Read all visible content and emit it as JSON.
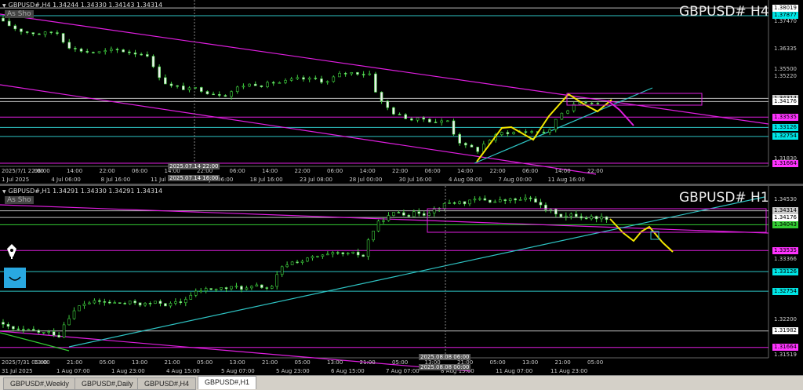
{
  "top_chart": {
    "symbol_info": "GBPUSD#,H4  1.34244 1.34330 1.34143 1.34314",
    "title": "GBPUSD#  H4",
    "as_show": "As Sho",
    "price_labels": [
      {
        "text": "1.38019",
        "bg": "#ffffff",
        "fg": "#000000",
        "y": 1.38019
      },
      {
        "text": "1.37877",
        "bg": "#00e5e5",
        "fg": "#000000",
        "y": 1.377
      },
      {
        "text": "1.37470",
        "bg": "",
        "fg": "#cccccc",
        "y": 1.3747
      },
      {
        "text": "1.36335",
        "bg": "",
        "fg": "#cccccc",
        "y": 1.36335
      },
      {
        "text": "1.35500",
        "bg": "",
        "fg": "#cccccc",
        "y": 1.355
      },
      {
        "text": "1.35220",
        "bg": "",
        "fg": "#cccccc",
        "y": 1.3522
      },
      {
        "text": "1.34314",
        "bg": "#cccccc",
        "fg": "#000000",
        "y": 1.3431
      },
      {
        "text": "1.34176",
        "bg": "#ffffff",
        "fg": "#000000",
        "y": 1.3418
      },
      {
        "text": "1.33535",
        "bg": "#ff33ff",
        "fg": "#000000",
        "y": 1.3354
      },
      {
        "text": "1.33126",
        "bg": "#00e5e5",
        "fg": "#000000",
        "y": 1.3312
      },
      {
        "text": "1.32754",
        "bg": "#00e5e5",
        "fg": "#000000",
        "y": 1.3275
      },
      {
        "text": "1.31830",
        "bg": "",
        "fg": "#cccccc",
        "y": 1.3183
      },
      {
        "text": "1.31664",
        "bg": "#ff33ff",
        "fg": "#000000",
        "y": 1.3165
      }
    ],
    "time_labels": [
      "2025/7/1 22:00",
      "06:00",
      "14:00",
      "22:00",
      "06:00",
      "14:00",
      "22:00",
      "06:00",
      "14:00",
      "22:00",
      "06:00",
      "14:00",
      "22:00",
      "06:00",
      "14:00",
      "22:00",
      "06:00",
      "14:00",
      "22:00"
    ],
    "date_labels": [
      "1 Jul 2025",
      "4 Jul 06:00",
      "8 Jul 16:00",
      "11 Jul 22:00",
      "16 Jul 06:00",
      "18 Jul 16:00",
      "23 Jul 08:00",
      "28 Jul 00:00",
      "30 Jul 16:00",
      "4 Aug 08:00",
      "7 Aug 00:00",
      "11 Aug 16:00"
    ],
    "crosshair_time_a": "2025.07.14 22:00",
    "crosshair_time_b": "2025.07.14 16:00"
  },
  "bottom_chart": {
    "symbol_info": "GBPUSD#,H1  1.34291 1.34330 1.34291 1.34314",
    "title": "GBPUSD#  H1",
    "as_show": "As Sho",
    "price_labels": [
      {
        "text": "1.34530",
        "bg": "",
        "fg": "#cccccc",
        "y": 1.3453
      },
      {
        "text": "1.34314",
        "bg": "#cccccc",
        "fg": "#000000",
        "y": 1.3431
      },
      {
        "text": "1.34176",
        "bg": "#ffffff",
        "fg": "#000000",
        "y": 1.3418
      },
      {
        "text": "1.34043",
        "bg": "#33cc33",
        "fg": "#000000",
        "y": 1.3404
      },
      {
        "text": "1.33535",
        "bg": "#ff33ff",
        "fg": "#000000",
        "y": 1.3354
      },
      {
        "text": "1.33366",
        "bg": "",
        "fg": "#cccccc",
        "y": 1.3337
      },
      {
        "text": "1.33126",
        "bg": "#00e5e5",
        "fg": "#000000",
        "y": 1.3313
      },
      {
        "text": "1.32754",
        "bg": "#00e5e5",
        "fg": "#000000",
        "y": 1.3275
      },
      {
        "text": "1.32200",
        "bg": "",
        "fg": "#cccccc",
        "y": 1.322
      },
      {
        "text": "1.31982",
        "bg": "#ffffff",
        "fg": "#000000",
        "y": 1.3198
      },
      {
        "text": "1.31664",
        "bg": "#ff33ff",
        "fg": "#000000",
        "y": 1.3166
      },
      {
        "text": "1.31519",
        "bg": "",
        "fg": "#cccccc",
        "y": 1.3152
      }
    ],
    "time_labels": [
      "2025/7/31 05:00",
      "13:00",
      "21:00",
      "05:00",
      "13:00",
      "21:00",
      "05:00",
      "13:00",
      "21:00",
      "05:00",
      "13:00",
      "21:00",
      "05:00",
      "13:00",
      "21:00",
      "05:00",
      "13:00",
      "21:00",
      "05:00"
    ],
    "date_labels": [
      "31 Jul 2025",
      "1 Aug 07:00",
      "1 Aug 23:00",
      "4 Aug 15:00",
      "5 Aug 07:00",
      "5 Aug 23:00",
      "6 Aug 15:00",
      "7 Aug 07:00",
      "8 Aug 15:00",
      "11 Aug 07:00",
      "11 Aug 23:00"
    ],
    "crosshair_time_a": "2025.08.08 06:00",
    "crosshair_time_b": "2025.08.08 00:00"
  },
  "tabs": [
    "GBPUSD#,Weekly",
    "GBPUSD#,Daily",
    "GBPUSD#,H4",
    "GBPUSD#,H1"
  ],
  "active_tab": "GBPUSD#,H1",
  "icons": {
    "pen": "pen-icon",
    "smile": "smile-icon"
  }
}
